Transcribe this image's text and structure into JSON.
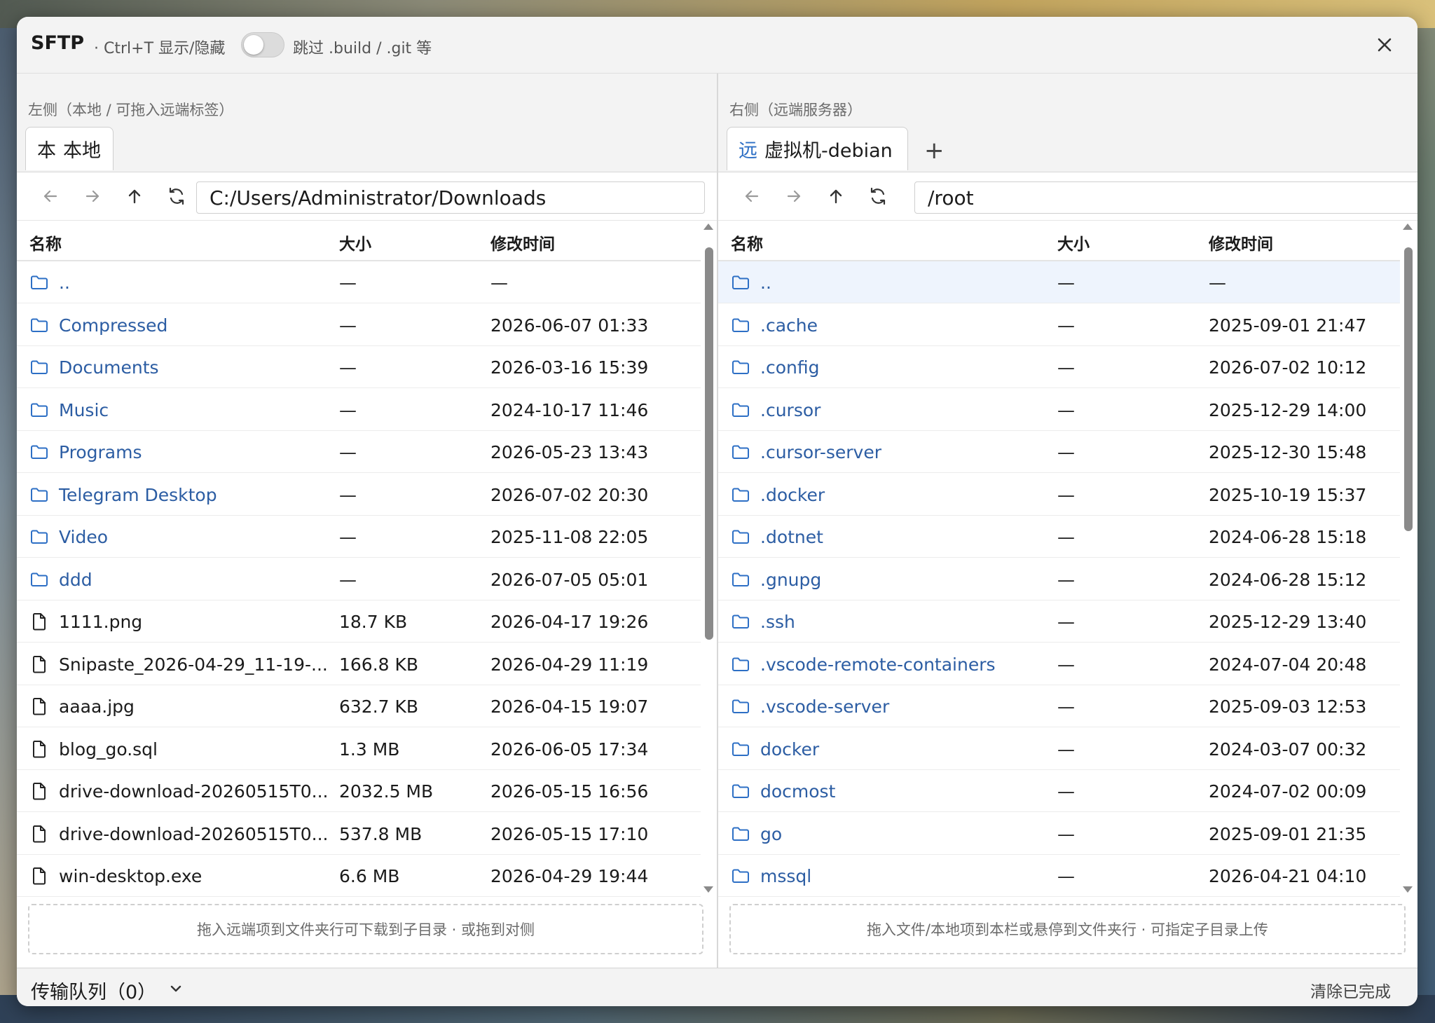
{
  "title_bar": {
    "app_name": "SFTP",
    "shortcut_hint": "· Ctrl+T 显示/隐藏",
    "skip_toggle_label": "跳过 .build / .git 等",
    "skip_toggle_on": false
  },
  "left_pane": {
    "label": "左侧（本地 / 可拖入远端标签）",
    "tabs": [
      {
        "tag": "本",
        "label": "本地"
      }
    ],
    "path": "C:/Users/Administrator/Downloads",
    "columns": {
      "name": "名称",
      "size": "大小",
      "mtime": "修改时间"
    },
    "rows": [
      {
        "type": "dir",
        "name": "..",
        "size": "—",
        "mtime": "—"
      },
      {
        "type": "dir",
        "name": "Compressed",
        "size": "—",
        "mtime": "2026-06-07 01:33"
      },
      {
        "type": "dir",
        "name": "Documents",
        "size": "—",
        "mtime": "2026-03-16 15:39"
      },
      {
        "type": "dir",
        "name": "Music",
        "size": "—",
        "mtime": "2024-10-17 11:46"
      },
      {
        "type": "dir",
        "name": "Programs",
        "size": "—",
        "mtime": "2026-05-23 13:43"
      },
      {
        "type": "dir",
        "name": "Telegram Desktop",
        "size": "—",
        "mtime": "2026-07-02 20:30"
      },
      {
        "type": "dir",
        "name": "Video",
        "size": "—",
        "mtime": "2025-11-08 22:05"
      },
      {
        "type": "dir",
        "name": "ddd",
        "size": "—",
        "mtime": "2026-07-05 05:01"
      },
      {
        "type": "file",
        "name": "1111.png",
        "size": "18.7 KB",
        "mtime": "2026-04-17 19:26"
      },
      {
        "type": "file",
        "name": "Snipaste_2026-04-29_11-19-...",
        "size": "166.8 KB",
        "mtime": "2026-04-29 11:19"
      },
      {
        "type": "file",
        "name": "aaaa.jpg",
        "size": "632.7 KB",
        "mtime": "2026-04-15 19:07"
      },
      {
        "type": "file",
        "name": "blog_go.sql",
        "size": "1.3 MB",
        "mtime": "2026-06-05 17:34"
      },
      {
        "type": "file",
        "name": "drive-download-20260515T0...",
        "size": "2032.5 MB",
        "mtime": "2026-05-15 16:56"
      },
      {
        "type": "file",
        "name": "drive-download-20260515T0...",
        "size": "537.8 MB",
        "mtime": "2026-05-15 17:10"
      },
      {
        "type": "file",
        "name": "win-desktop.exe",
        "size": "6.6 MB",
        "mtime": "2026-04-29 19:44"
      }
    ],
    "scroll_position": 0.0,
    "dropzone_text": "拖入远端项到文件夹行可下载到子目录 · 或拖到对侧"
  },
  "right_pane": {
    "label": "右侧（远端服务器）",
    "tabs": [
      {
        "tag": "远",
        "label": "虚拟机-debian"
      }
    ],
    "add_tab": "+",
    "path": "/root",
    "columns": {
      "name": "名称",
      "size": "大小",
      "mtime": "修改时间"
    },
    "rows": [
      {
        "type": "dir",
        "name": "..",
        "size": "—",
        "mtime": "—",
        "highlighted": true
      },
      {
        "type": "dir",
        "name": ".cache",
        "size": "—",
        "mtime": "2025-09-01 21:47"
      },
      {
        "type": "dir",
        "name": ".config",
        "size": "—",
        "mtime": "2026-07-02 10:12"
      },
      {
        "type": "dir",
        "name": ".cursor",
        "size": "—",
        "mtime": "2025-12-29 14:00"
      },
      {
        "type": "dir",
        "name": ".cursor-server",
        "size": "—",
        "mtime": "2025-12-30 15:48"
      },
      {
        "type": "dir",
        "name": ".docker",
        "size": "—",
        "mtime": "2025-10-19 15:37"
      },
      {
        "type": "dir",
        "name": ".dotnet",
        "size": "—",
        "mtime": "2024-06-28 15:18"
      },
      {
        "type": "dir",
        "name": ".gnupg",
        "size": "—",
        "mtime": "2024-06-28 15:12"
      },
      {
        "type": "dir",
        "name": ".ssh",
        "size": "—",
        "mtime": "2025-12-29 13:40"
      },
      {
        "type": "dir",
        "name": ".vscode-remote-containers",
        "size": "—",
        "mtime": "2024-07-04 20:48"
      },
      {
        "type": "dir",
        "name": ".vscode-server",
        "size": "—",
        "mtime": "2025-09-03 12:53"
      },
      {
        "type": "dir",
        "name": "docker",
        "size": "—",
        "mtime": "2024-03-07 00:32"
      },
      {
        "type": "dir",
        "name": "docmost",
        "size": "—",
        "mtime": "2024-07-02 00:09"
      },
      {
        "type": "dir",
        "name": "go",
        "size": "—",
        "mtime": "2025-09-01 21:35"
      },
      {
        "type": "dir",
        "name": "mssql",
        "size": "—",
        "mtime": "2026-04-21 04:10"
      }
    ],
    "scroll_position": 0.0,
    "dropzone_text": "拖入文件/本地项到本栏或悬停到文件夹行 · 可指定子目录上传"
  },
  "queue": {
    "title": "传输队列（0）",
    "clear_label": "清除已完成"
  },
  "colors": {
    "folder_icon": "#2d6fc5",
    "folder_name": "#2c5da3",
    "row_highlight": "#eef4fd",
    "window_bg": "#f3f3f3"
  },
  "icons": {
    "close": "close-icon",
    "back": "arrow-left-icon",
    "forward": "arrow-right-icon",
    "up": "arrow-up-icon",
    "refresh": "refresh-icon",
    "folder": "folder-icon",
    "file": "file-icon",
    "chevron": "chevron-down-icon"
  }
}
